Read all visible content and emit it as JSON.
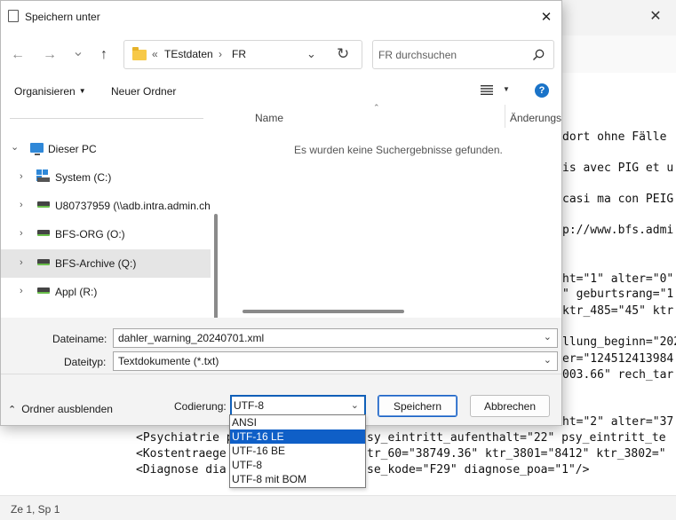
{
  "editor": {
    "lines": [
      "dort ohne Fälle",
      "is avec PIG et u",
      "casi ma con PEIG",
      "p://www.bfs.admi",
      "ht=\"1\" alter=\"0\"",
      "\" geburtsrang=\"1",
      "ktr_485=\"45\" ktr",
      "llung_beginn=\"202",
      "er=\"124512413984",
      "003.66\" rech_tar",
      "ht=\"2\" alter=\"37",
      "<Psychiatrie p",
      "sy_eintritt_aufenthalt=\"22\" psy_eintritt_te",
      "<Kostentraege",
      "tr_60=\"38749.36\" ktr_3801=\"8412\" ktr_3802=\"",
      "<Diagnose dia",
      "se_kode=\"F29\" diagnose_poa=\"1\"/>"
    ],
    "status": "Ze 1, Sp 1",
    "close_glyph": "✕"
  },
  "dialog": {
    "title": "Speichern unter",
    "close_glyph": "✕",
    "nav": {
      "back_glyph": "←",
      "forward_glyph": "→",
      "history_glyph": "⌄",
      "up_glyph": "↑"
    },
    "address": {
      "sep": "«",
      "crumbs": [
        "TEstdaten",
        "FR"
      ],
      "chevron": "⌄",
      "refresh": "↻"
    },
    "search_placeholder": "FR durchsuchen",
    "toolbar": {
      "organize": "Organisieren",
      "organize_caret": "▼",
      "new_folder": "Neuer Ordner",
      "view_caret": "▼",
      "help": "?"
    },
    "tree": [
      {
        "label": "Dieser PC",
        "chevron": "⌄"
      },
      {
        "label": "System (C:)",
        "chevron": "›"
      },
      {
        "label": "U80737959 (\\\\adb.intra.admin.ch",
        "chevron": "›"
      },
      {
        "label": "BFS-ORG (O:)",
        "chevron": "›"
      },
      {
        "label": "BFS-Archive (Q:)",
        "chevron": "›"
      },
      {
        "label": "Appl (R:)",
        "chevron": "›"
      }
    ],
    "columns": {
      "name": "Name",
      "changed": "Änderungsd",
      "sort_glyph": "⌃"
    },
    "empty_message": "Es wurden keine Suchergebnisse gefunden.",
    "filename_label": "Dateiname:",
    "filename_value": "dahler_warning_20240701.xml",
    "filetype_label": "Dateityp:",
    "filetype_value": "Textdokumente (*.txt)",
    "field_chevron": "⌄",
    "hide_folders": "Ordner ausblenden",
    "hide_chevron": "⌃",
    "encoding_label": "Codierung:",
    "encoding_value": "UTF-8",
    "encoding_options": [
      "ANSI",
      "UTF-16 LE",
      "UTF-16 BE",
      "UTF-8",
      "UTF-8 mit BOM"
    ],
    "encoding_highlighted": "UTF-16 LE",
    "save_button": "Speichern",
    "cancel_button": "Abbrechen"
  }
}
